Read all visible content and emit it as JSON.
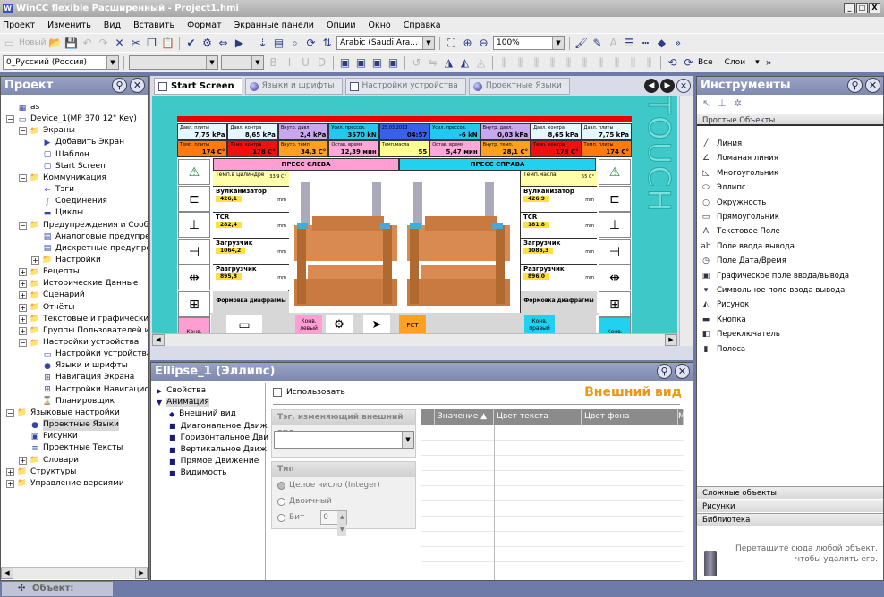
{
  "window": {
    "title": "WinCC flexible Расширенный - Project1.hmi",
    "controls": [
      "_",
      "□",
      "X"
    ]
  },
  "menu": [
    "Проект",
    "Изменить",
    "Вид",
    "Вставить",
    "Формат",
    "Экранные панели",
    "Опции",
    "Окно",
    "Справка"
  ],
  "toolbar1": {
    "new_label": "Новый",
    "font_combo": "Arabic (Saudi Ara...",
    "zoom_combo": "100%"
  },
  "toolbar2": {
    "language_combo": "0_Русский (Россия)",
    "all_label": "Все",
    "layers_label": "Слои"
  },
  "project_panel": {
    "title": "Проект",
    "tree": [
      {
        "label": "as",
        "level": 0,
        "exp": "",
        "icon": "▦"
      },
      {
        "label": "Device_1(MP 370 12\" Key)",
        "level": 0,
        "exp": "-",
        "icon": "▭"
      },
      {
        "label": "Экраны",
        "level": 1,
        "exp": "-",
        "icon": "📁"
      },
      {
        "label": "Добавить Экран",
        "level": 2,
        "exp": "",
        "icon": "▶"
      },
      {
        "label": "Шаблон",
        "level": 2,
        "exp": "",
        "icon": "▢"
      },
      {
        "label": "Start Screen",
        "level": 2,
        "exp": "",
        "icon": "▢"
      },
      {
        "label": "Коммуникация",
        "level": 1,
        "exp": "-",
        "icon": "📁"
      },
      {
        "label": "Тэги",
        "level": 2,
        "exp": "",
        "icon": "⇐"
      },
      {
        "label": "Соединения",
        "level": 2,
        "exp": "",
        "icon": "∫"
      },
      {
        "label": "Циклы",
        "level": 2,
        "exp": "",
        "icon": "▬"
      },
      {
        "label": "Предупреждения и Сообщ",
        "level": 1,
        "exp": "-",
        "icon": "📁"
      },
      {
        "label": "Аналоговые предупреж",
        "level": 2,
        "exp": "",
        "icon": "▤"
      },
      {
        "label": "Дискретные предупреж",
        "level": 2,
        "exp": "",
        "icon": "▤"
      },
      {
        "label": "Настройки",
        "level": 2,
        "exp": "+",
        "icon": "📁"
      },
      {
        "label": "Рецепты",
        "level": 1,
        "exp": "+",
        "icon": "📁"
      },
      {
        "label": "Исторические Данные",
        "level": 1,
        "exp": "+",
        "icon": "📁"
      },
      {
        "label": "Сценарий",
        "level": 1,
        "exp": "+",
        "icon": "📁"
      },
      {
        "label": "Отчёты",
        "level": 1,
        "exp": "+",
        "icon": "📁"
      },
      {
        "label": "Текстовые и графические",
        "level": 1,
        "exp": "+",
        "icon": "📁"
      },
      {
        "label": "Группы Пользователей и Е",
        "level": 1,
        "exp": "+",
        "icon": "📁"
      },
      {
        "label": "Настройки устройства",
        "level": 1,
        "exp": "-",
        "icon": "📁"
      },
      {
        "label": "Настройки устройства",
        "level": 2,
        "exp": "",
        "icon": "▭"
      },
      {
        "label": "Языки и шрифты",
        "level": 2,
        "exp": "",
        "icon": "●"
      },
      {
        "label": "Навигация Экрана",
        "level": 2,
        "exp": "",
        "icon": "⊞"
      },
      {
        "label": "Настройки Навигацион",
        "level": 2,
        "exp": "",
        "icon": "⊞"
      },
      {
        "label": "Планировщик",
        "level": 2,
        "exp": "",
        "icon": "⌛"
      },
      {
        "label": "Языковые настройки",
        "level": 0,
        "exp": "-",
        "icon": "📁"
      },
      {
        "label": "Проектные Языки",
        "level": 1,
        "exp": "",
        "icon": "●",
        "selected": true
      },
      {
        "label": "Рисунки",
        "level": 1,
        "exp": "",
        "icon": "▣"
      },
      {
        "label": "Проектные Тексты",
        "level": 1,
        "exp": "",
        "icon": "≡"
      },
      {
        "label": "Словари",
        "level": 1,
        "exp": "+",
        "icon": "📁"
      },
      {
        "label": "Структуры",
        "level": 0,
        "exp": "+",
        "icon": "📁"
      },
      {
        "label": "Управление версиями",
        "level": 0,
        "exp": "+",
        "icon": "📁"
      }
    ]
  },
  "tabs": [
    {
      "label": "Start Screen",
      "active": true
    },
    {
      "label": "Языки и шрифты"
    },
    {
      "label": "Настройки устройства"
    },
    {
      "label": "Проектные Языки"
    }
  ],
  "editor": {
    "watermark": "TOUCH"
  },
  "hmi": {
    "row1": [
      {
        "label": "Давл. плиты",
        "value": "7,75 kPa",
        "color": "#e6f8ff"
      },
      {
        "label": "Давл. контра",
        "value": "8,65 kPa",
        "color": "#e6f8ff"
      },
      {
        "label": "Внутр. давл.",
        "value": "2,4 kPa",
        "color": "#c9a6f0"
      },
      {
        "label": "Усил. прессов.",
        "value": "3570 kN",
        "color": "#22c8f0"
      },
      {
        "label": "25.03.2013",
        "value": "04:57",
        "color": "#3a60e8"
      },
      {
        "label": "Усил. прессов.",
        "value": "-6 kN",
        "color": "#22c8f0"
      },
      {
        "label": "Внутр. давл.",
        "value": "0,03 kPa",
        "color": "#c9a6f0"
      },
      {
        "label": "Давл. контра",
        "value": "8,65 kPa",
        "color": "#e6f8ff"
      },
      {
        "label": "Давл. плиты",
        "value": "7,75 kPa",
        "color": "#e6f8ff"
      }
    ],
    "row2": [
      {
        "label": "Темп. плиты",
        "value": "174 C°",
        "color": "#ff7a10"
      },
      {
        "label": "Темп. контра",
        "value": "178 C°",
        "color": "#f01010"
      },
      {
        "label": "Внутр. темп.",
        "value": "34,3 C°",
        "color": "#ffa020"
      },
      {
        "label": "Остав. время",
        "value": "12,39 мин",
        "color": "#ffa8d8"
      },
      {
        "label": "Темп.масла",
        "value": "55",
        "color": "#ffff90"
      },
      {
        "label": "Остав. время",
        "value": "5,47 мин",
        "color": "#ffa8d8"
      },
      {
        "label": "Внутр. темп.",
        "value": "28,1 C°",
        "color": "#ffa020"
      },
      {
        "label": "Темп. контра",
        "value": "178 C°",
        "color": "#f01010"
      },
      {
        "label": "Темп. плиты",
        "value": "174 C°",
        "color": "#ff7a10"
      }
    ],
    "press_left": "ПРЕСС СЛЕВА",
    "press_right": "ПРЕСС СПРАВА",
    "left_panel": {
      "temp_label": "Темп.в цилиндре",
      "temp_value": "33,9 C°",
      "params": [
        {
          "name": "Вулканизатор",
          "value": "426,1",
          "unit": "mm"
        },
        {
          "name": "TCR",
          "value": "282,4",
          "unit": "mm"
        },
        {
          "name": "Загрузчик",
          "value": "1064,2",
          "unit": "mm"
        },
        {
          "name": "Разгрузчик",
          "value": "895,8",
          "unit": "mm"
        }
      ],
      "forming": "Формовка диафрагмы"
    },
    "right_panel": {
      "temp_label": "Темп.масла",
      "temp_value": "55 C°",
      "params": [
        {
          "name": "Вулканизатор",
          "value": "426,9",
          "unit": "mm"
        },
        {
          "name": "TCR",
          "value": "181,8",
          "unit": "mm"
        },
        {
          "name": "Загрузчик",
          "value": "1086,3",
          "unit": "mm"
        },
        {
          "name": "Разгрузчик",
          "value": "896,0",
          "unit": "mm"
        }
      ],
      "forming": "Формовка диафрагмы"
    },
    "conv_left": "Конв. левый",
    "conv_right": "Конв. правый",
    "bottom_conv_left": "Конв. левый",
    "bottom_conv_right": "Конв. правый",
    "fct": "FCT"
  },
  "properties": {
    "title": "Ellipse_1 (Эллипс)",
    "nav": [
      {
        "label": "Свойства",
        "type": "collapsed"
      },
      {
        "label": "Анимация",
        "type": "expanded"
      },
      {
        "label": "Внешний вид",
        "type": "current"
      },
      {
        "label": "Диагональное Движ",
        "type": "item"
      },
      {
        "label": "Горизонтальное Дви",
        "type": "item"
      },
      {
        "label": "Вертикальное Движ",
        "type": "item"
      },
      {
        "label": "Прямое Движение",
        "type": "item"
      },
      {
        "label": "Видимость",
        "type": "item"
      }
    ],
    "use_label": "Использовать",
    "section_title": "Внешний вид",
    "tag_group": "Тэг, изменяющий внешний вид",
    "tag_value": "",
    "type_group": "Тип",
    "type_options": [
      "Целое число (Integer)",
      "Двоичный",
      "Бит"
    ],
    "bit_value": "0",
    "grid_columns": [
      "Значение",
      "Цвет текста",
      "Цвет фона",
      "М"
    ]
  },
  "tools_panel": {
    "title": "Инструменты",
    "simple_objects": "Простые Объекты",
    "items": [
      {
        "label": "Линия",
        "icon": "╱"
      },
      {
        "label": "Ломаная линия",
        "icon": "∠"
      },
      {
        "label": "Многоугольник",
        "icon": "◺"
      },
      {
        "label": "Эллипс",
        "icon": "⬭"
      },
      {
        "label": "Окружность",
        "icon": "○"
      },
      {
        "label": "Прямоугольник",
        "icon": "▭"
      },
      {
        "label": "Текстовое Поле",
        "icon": "A"
      },
      {
        "label": "Поле ввода вывода",
        "icon": "ab"
      },
      {
        "label": "Поле Дата/Время",
        "icon": "◷"
      },
      {
        "label": "Графическое поле ввода/вывода",
        "icon": "▣"
      },
      {
        "label": "Символьное поле ввода вывода",
        "icon": "▾"
      },
      {
        "label": "Рисунок",
        "icon": "◭"
      },
      {
        "label": "Кнопка",
        "icon": "▬"
      },
      {
        "label": "Переключатель",
        "icon": "◧"
      },
      {
        "label": "Полоса",
        "icon": "▮"
      }
    ],
    "sections": [
      "Сложные объекты",
      "Рисунки",
      "Библиотека"
    ],
    "trash_hint": "Перетащите сюда любой объект, чтобы удалить его."
  },
  "status": {
    "object_label": "Объект:"
  }
}
